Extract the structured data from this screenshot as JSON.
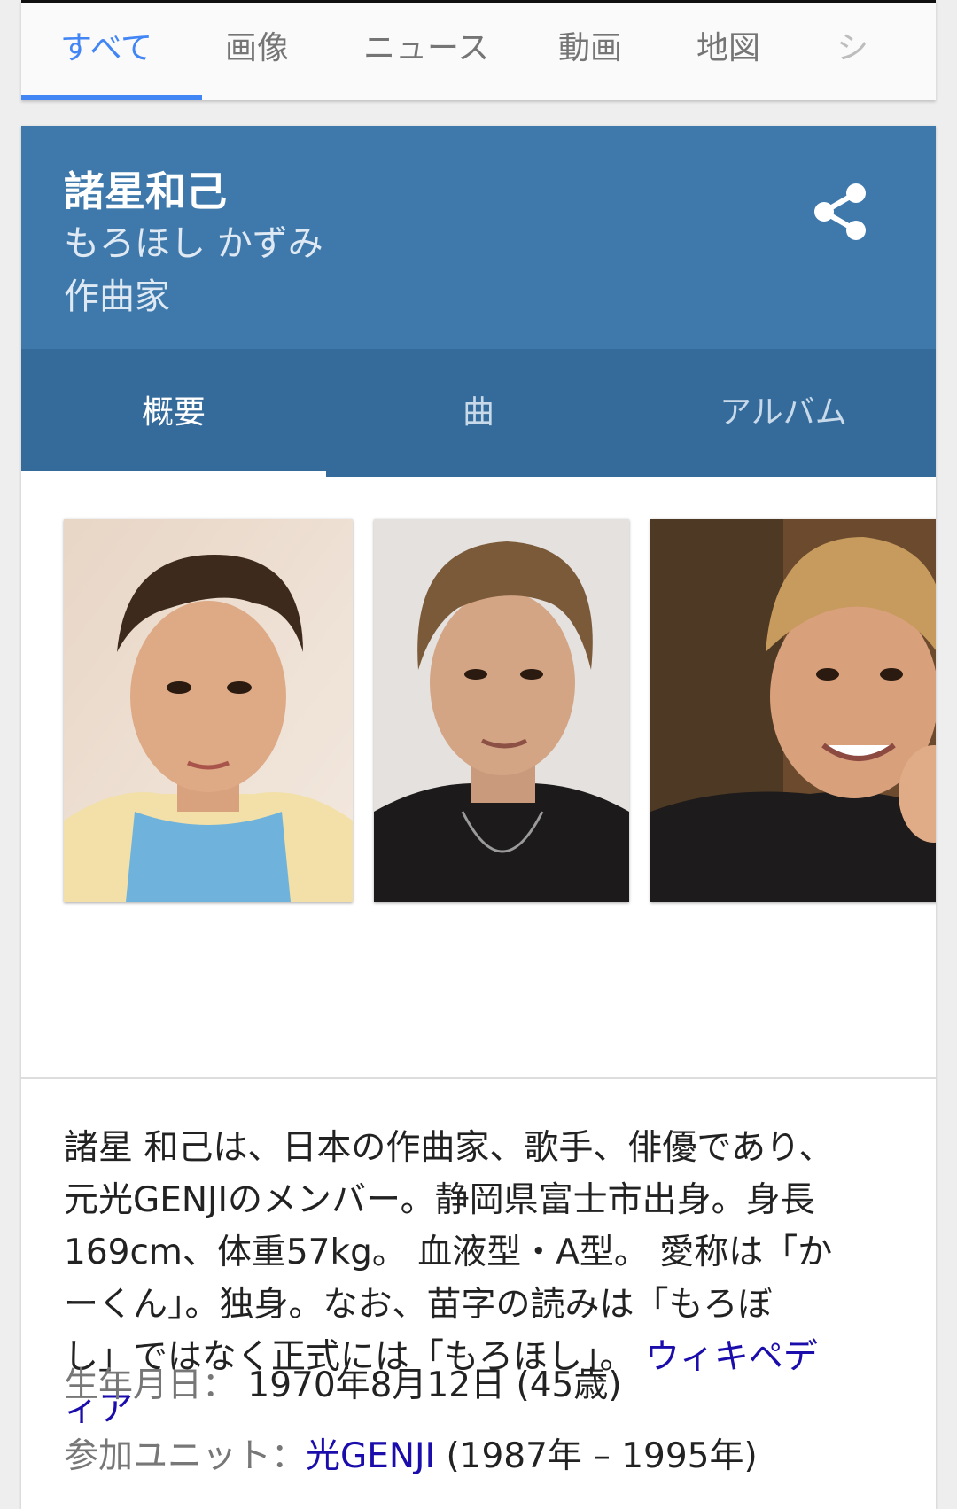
{
  "search_tabs": [
    {
      "label": "すべて",
      "active": true
    },
    {
      "label": "画像",
      "active": false
    },
    {
      "label": "ニュース",
      "active": false
    },
    {
      "label": "動画",
      "active": false
    },
    {
      "label": "地図",
      "active": false
    },
    {
      "label": "シ",
      "active": false
    }
  ],
  "entity": {
    "name": "諸星和己",
    "reading": "もろほし かずみ",
    "role": "作曲家",
    "share_icon": "share-icon"
  },
  "card_tabs": [
    {
      "label": "概要",
      "active": true
    },
    {
      "label": "曲",
      "active": false
    },
    {
      "label": "アルバム",
      "active": false
    }
  ],
  "photos": [
    {
      "alt": "photo-1"
    },
    {
      "alt": "photo-2"
    },
    {
      "alt": "photo-3"
    }
  ],
  "description": {
    "lines": [
      "諸星 和己は、日本の作曲家、歌手、俳優であり、",
      "元光GENJIのメンバー。静岡県富士市出身。身長",
      "169cm、体重57kg。 血液型・A型。 愛称は「か",
      "ーくん」。独身。なお、苗字の読みは「もろぼ"
    ],
    "last_line": "し」ではなく正式には「もろほし」。 ",
    "source_link_part1": "ウィキペデ",
    "source_link_part2": "ィア"
  },
  "facts": {
    "birth_label": "生年月日：",
    "birth_value": "1970年8月12日 (45歳)",
    "unit_label": "参加ユニット：",
    "unit_link": "光GENJI",
    "unit_period": " (1987年 – 1995年)"
  },
  "colors": {
    "accent": "#4285f4",
    "header": "#3f79ab",
    "subtabs": "#346b9b",
    "link": "#1a0dab"
  }
}
